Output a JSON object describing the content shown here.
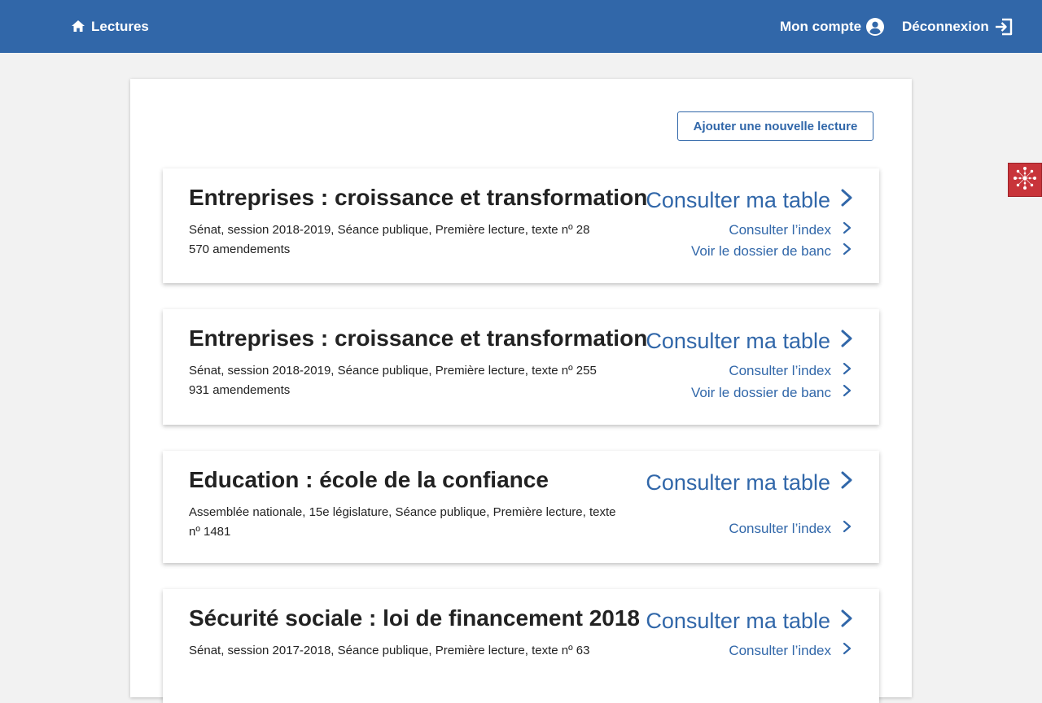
{
  "header": {
    "home_label": "Lectures",
    "account_label": "Mon compte",
    "logout_label": "Déconnexion"
  },
  "actions": {
    "add_reading_label": "Ajouter une nouvelle lecture"
  },
  "readings": [
    {
      "title": "Entreprises : croissance et transformation",
      "meta": [
        "Sénat, session 2018-2019, Séance publique, Première lecture, texte nº 28",
        "570 amendements"
      ],
      "main_link": "Consulter ma table",
      "index_link": "Consulter l’index",
      "dossier_link": "Voir le dossier de banc"
    },
    {
      "title": "Entreprises : croissance et transformation",
      "meta": [
        "Sénat, session 2018-2019, Séance publique, Première lecture, texte nº 255",
        "931 amendements"
      ],
      "main_link": "Consulter ma table",
      "index_link": "Consulter l’index",
      "dossier_link": "Voir le dossier de banc"
    },
    {
      "title": "Education : école de la confiance",
      "meta": [
        "Assemblée nationale, 15e législature, Séance publique, Première lecture, texte",
        "nº 1481"
      ],
      "main_link": "Consulter ma table",
      "index_link": "Consulter l’index"
    },
    {
      "title": "Sécurité sociale : loi de financement 2018",
      "meta": [
        "Sénat, session 2017-2018, Séance publique, Première lecture, texte nº 63"
      ],
      "main_link": "Consulter ma table",
      "index_link": "Consulter l’index"
    }
  ],
  "colors": {
    "header_bg": "#3167a9",
    "link": "#3167a9",
    "page_bg": "#f2f2f2",
    "widget": "#c8343a"
  },
  "icons": {
    "home": "home-icon",
    "account": "account-circle-icon",
    "logout": "logout-icon",
    "chevron": "chevron-right-icon",
    "widget": "network-icon"
  }
}
